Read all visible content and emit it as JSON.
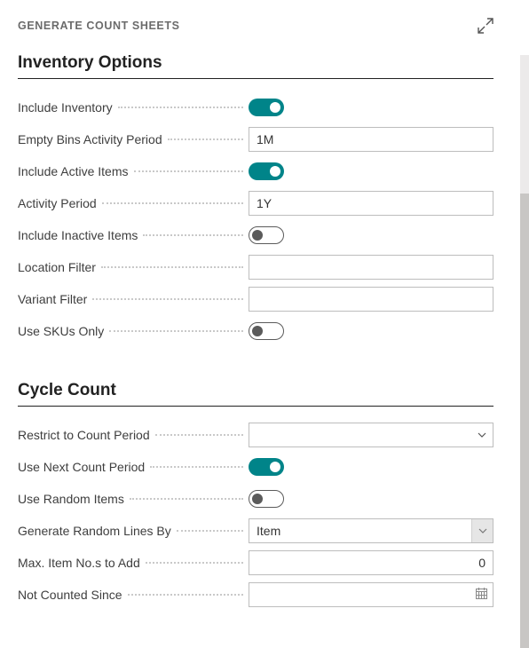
{
  "header": {
    "title": "GENERATE COUNT SHEETS"
  },
  "sections": {
    "inventory": {
      "title": "Inventory Options",
      "fields": {
        "include_inventory": {
          "label": "Include Inventory",
          "value": true
        },
        "empty_bins_period": {
          "label": "Empty Bins Activity Period",
          "value": "1M"
        },
        "include_active": {
          "label": "Include Active Items",
          "value": true
        },
        "activity_period": {
          "label": "Activity Period",
          "value": "1Y"
        },
        "include_inactive": {
          "label": "Include Inactive Items",
          "value": false
        },
        "location_filter": {
          "label": "Location Filter",
          "value": ""
        },
        "variant_filter": {
          "label": "Variant Filter",
          "value": ""
        },
        "use_skus_only": {
          "label": "Use SKUs Only",
          "value": false
        }
      }
    },
    "cycle": {
      "title": "Cycle Count",
      "fields": {
        "restrict_period": {
          "label": "Restrict to Count Period",
          "value": ""
        },
        "use_next_period": {
          "label": "Use Next Count Period",
          "value": true
        },
        "use_random": {
          "label": "Use Random Items",
          "value": false
        },
        "random_by": {
          "label": "Generate Random Lines By",
          "value": "Item"
        },
        "max_items": {
          "label": "Max. Item No.s to Add",
          "value": "0"
        },
        "not_counted_since": {
          "label": "Not Counted Since",
          "value": ""
        }
      }
    }
  }
}
